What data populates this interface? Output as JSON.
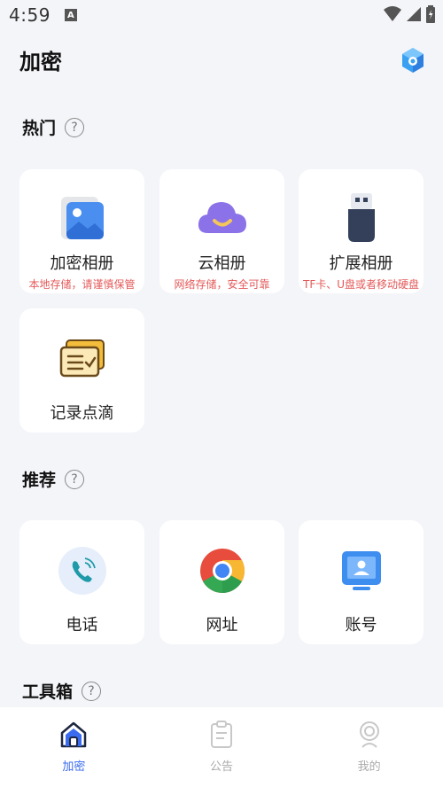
{
  "status": {
    "time": "4:59",
    "a_badge": "A"
  },
  "header": {
    "title": "加密",
    "right_icon": "cube-logo-icon"
  },
  "sections": {
    "hot": {
      "title": "热门",
      "help": "?"
    },
    "recommend": {
      "title": "推荐",
      "help": "?"
    },
    "toolbox": {
      "title": "工具箱",
      "help": "?"
    }
  },
  "hot_cards": [
    {
      "label": "加密相册",
      "sub": "本地存储，请谨慎保管",
      "icon": "photo-album-icon"
    },
    {
      "label": "云相册",
      "sub": "网络存储，安全可靠",
      "icon": "cloud-icon"
    },
    {
      "label": "扩展相册",
      "sub": "TF卡、U盘或者移动硬盘",
      "icon": "usb-drive-icon"
    },
    {
      "label": "记录点滴",
      "sub": "",
      "icon": "notes-icon"
    }
  ],
  "recommend_cards": [
    {
      "label": "电话",
      "icon": "phone-icon"
    },
    {
      "label": "网址",
      "icon": "chrome-icon"
    },
    {
      "label": "账号",
      "icon": "account-icon"
    }
  ],
  "tabs": [
    {
      "label": "加密",
      "active": true,
      "icon": "home-icon"
    },
    {
      "label": "公告",
      "active": false,
      "icon": "clipboard-icon"
    },
    {
      "label": "我的",
      "active": false,
      "icon": "profile-icon"
    }
  ],
  "colors": {
    "accent": "#3b6cf0",
    "warning_text": "#e45a5a",
    "background": "#f4f5f9"
  }
}
